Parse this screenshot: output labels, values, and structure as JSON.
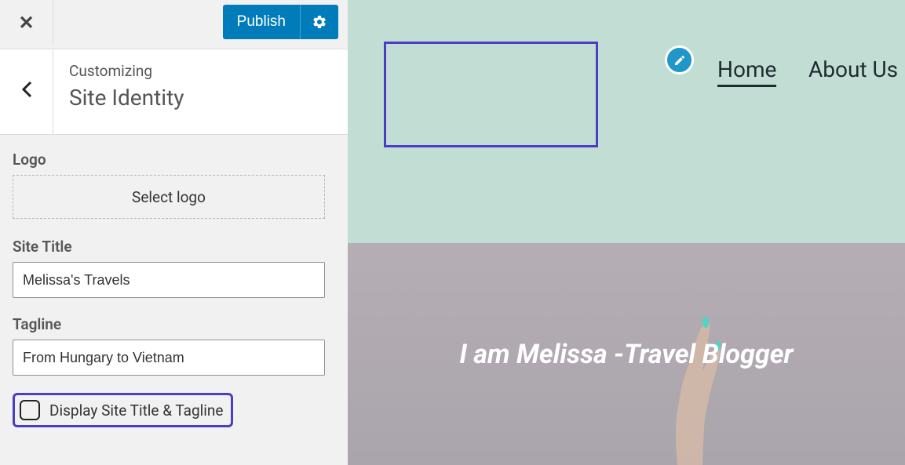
{
  "topbar": {
    "publish_label": "Publish"
  },
  "header": {
    "customizing": "Customizing",
    "section": "Site Identity"
  },
  "fields": {
    "logo_label": "Logo",
    "select_logo": "Select logo",
    "site_title_label": "Site Title",
    "site_title_value": "Melissa's Travels",
    "tagline_label": "Tagline",
    "tagline_value": "From Hungary to Vietnam",
    "display_checkbox_label": "Display Site Title & Tagline"
  },
  "preview": {
    "nav": {
      "home": "Home",
      "about": "About Us"
    },
    "hero_title": "I am Melissa -Travel Blogger"
  }
}
